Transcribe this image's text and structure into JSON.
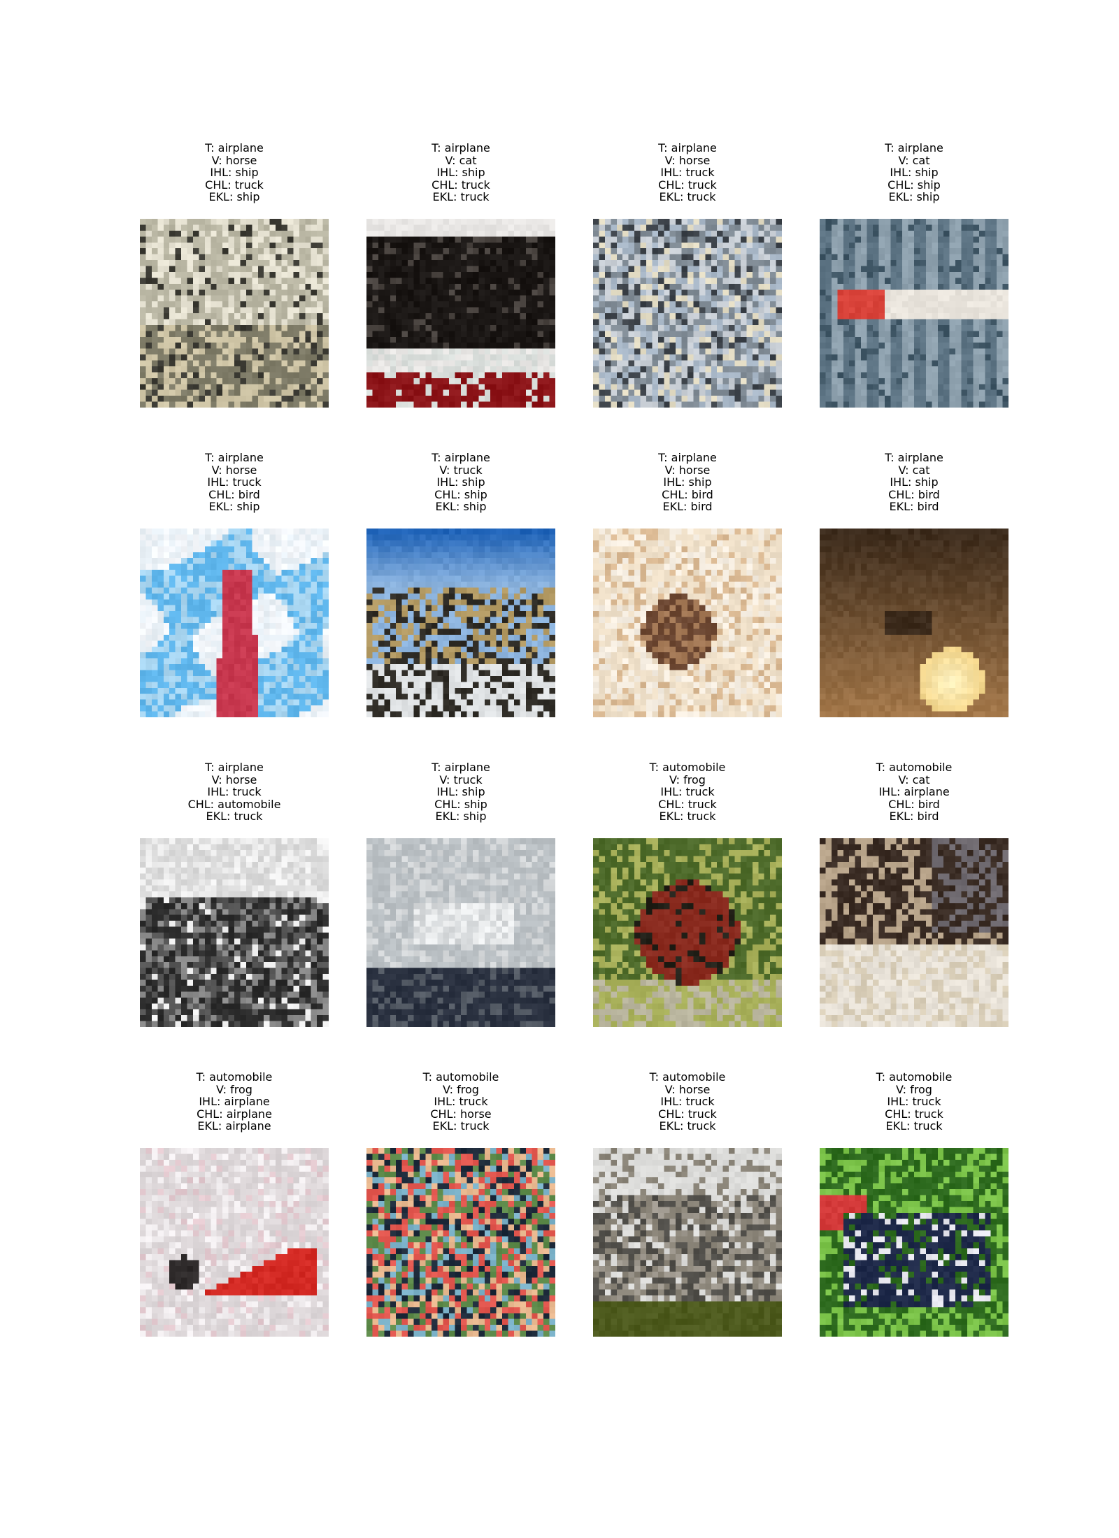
{
  "panels": [
    {
      "t": "T: airplane",
      "v": "V: horse",
      "ihl": "IHL: ship",
      "chl": "CHL: truck",
      "ekl": "EKL: ship",
      "scene": "airplane-ground-crowd",
      "colors": [
        "#b9b6a3",
        "#7d7a66",
        "#e6e2d2",
        "#3b3a33",
        "#cfc5a6"
      ]
    },
    {
      "t": "T: airplane",
      "v": "V: cat",
      "ihl": "IHL: ship",
      "chl": "CHL: truck",
      "ekl": "EKL: truck",
      "scene": "dark-bus-red-stripe",
      "colors": [
        "#e8e6e4",
        "#1a1614",
        "#8c1418",
        "#d9dedb",
        "#4a4440"
      ]
    },
    {
      "t": "T: airplane",
      "v": "V: horse",
      "ihl": "IHL: truck",
      "chl": "CHL: truck",
      "ekl": "EKL: truck",
      "scene": "grey-machinery",
      "colors": [
        "#7f8a94",
        "#c9cfd6",
        "#3c4249",
        "#a9b8c8",
        "#e3dcc4"
      ]
    },
    {
      "t": "T: airplane",
      "v": "V: cat",
      "ihl": "IHL: ship",
      "chl": "CHL: ship",
      "ekl": "EKL: ship",
      "scene": "jet-against-striped-sky",
      "colors": [
        "#5d7484",
        "#8ea1ae",
        "#d9433a",
        "#e9e4dc",
        "#3e5564"
      ]
    },
    {
      "t": "T: airplane",
      "v": "V: horse",
      "ihl": "IHL: truck",
      "chl": "CHL: bird",
      "ekl": "EKL: ship",
      "scene": "red-tower-blue-sky",
      "colors": [
        "#5fb6ec",
        "#f4f7fb",
        "#c8384f",
        "#a9d6f1",
        "#e8f0f6"
      ]
    },
    {
      "t": "T: airplane",
      "v": "V: truck",
      "ihl": "IHL: ship",
      "chl": "CHL: ship",
      "ekl": "EKL: ship",
      "scene": "camo-vehicle-blue-sky",
      "colors": [
        "#1f63b8",
        "#8db4de",
        "#b39a63",
        "#2f2c26",
        "#dfe2e4"
      ]
    },
    {
      "t": "T: airplane",
      "v": "V: horse",
      "ihl": "IHL: ship",
      "chl": "CHL: bird",
      "ekl": "EKL: bird",
      "scene": "wreck-on-sand",
      "colors": [
        "#efe0c9",
        "#d9b892",
        "#6b4631",
        "#f6eee2",
        "#a57a57"
      ]
    },
    {
      "t": "T: airplane",
      "v": "V: cat",
      "ihl": "IHL: ship",
      "chl": "CHL: bird",
      "ekl": "EKL: bird",
      "scene": "plane-at-sunset",
      "colors": [
        "#3c2b1c",
        "#a4784a",
        "#f3d58a",
        "#fff4c4",
        "#6d4b2c"
      ]
    },
    {
      "t": "T: airplane",
      "v": "V: horse",
      "ihl": "IHL: truck",
      "chl": "CHL: automobile",
      "ekl": "EKL: truck",
      "scene": "grayscale-crowd",
      "colors": [
        "#d8d8d8",
        "#2b2b2b",
        "#8a8a8a",
        "#555555",
        "#f0f0f0"
      ]
    },
    {
      "t": "T: airplane",
      "v": "V: truck",
      "ihl": "IHL: ship",
      "chl": "CHL: ship",
      "ekl": "EKL: ship",
      "scene": "plane-grey-sky-dark-ground",
      "colors": [
        "#b9bfc3",
        "#d4d7d9",
        "#2a3140",
        "#eef0f1",
        "#555c66"
      ]
    },
    {
      "t": "T: automobile",
      "v": "V: frog",
      "ihl": "IHL: truck",
      "chl": "CHL: truck",
      "ekl": "EKL: truck",
      "scene": "red-car-foliage",
      "colors": [
        "#4d6a2a",
        "#8a2b1f",
        "#222018",
        "#b9b59e",
        "#a8b05a"
      ]
    },
    {
      "t": "T: automobile",
      "v": "V: cat",
      "ihl": "IHL: airplane",
      "chl": "CHL: bird",
      "ekl": "EKL: bird",
      "scene": "white-car-dark-background",
      "colors": [
        "#3a2c24",
        "#e9e3d9",
        "#d9ceb8",
        "#6f6a70",
        "#b8a48a"
      ]
    },
    {
      "t": "T: automobile",
      "v": "V: frog",
      "ihl": "IHL: airplane",
      "chl": "CHL: airplane",
      "ekl": "EKL: airplane",
      "scene": "red-sports-car",
      "colors": [
        "#dcd6d8",
        "#d42a24",
        "#f2eef0",
        "#2e2a2a",
        "#e3c9cf"
      ]
    },
    {
      "t": "T: automobile",
      "v": "V: frog",
      "ihl": "IHL: truck",
      "chl": "CHL: horse",
      "ekl": "EKL: truck",
      "scene": "colorful-crash",
      "colors": [
        "#1d2a3a",
        "#e2574f",
        "#5d8a4a",
        "#e9b990",
        "#7ab1c8"
      ]
    },
    {
      "t": "T: automobile",
      "v": "V: horse",
      "ihl": "IHL: truck",
      "chl": "CHL: truck",
      "ekl": "EKL: truck",
      "scene": "vintage-cars-lawn",
      "colors": [
        "#dcdcda",
        "#514f4a",
        "#8a8478",
        "#4d5a1d",
        "#a09a90"
      ]
    },
    {
      "t": "T: automobile",
      "v": "V: frog",
      "ihl": "IHL: truck",
      "chl": "CHL: truck",
      "ekl": "EKL: truck",
      "scene": "blue-car-green-trees",
      "colors": [
        "#2d6a1e",
        "#1f2a4a",
        "#d43a3a",
        "#7cc44a",
        "#e8e8f0"
      ]
    }
  ]
}
